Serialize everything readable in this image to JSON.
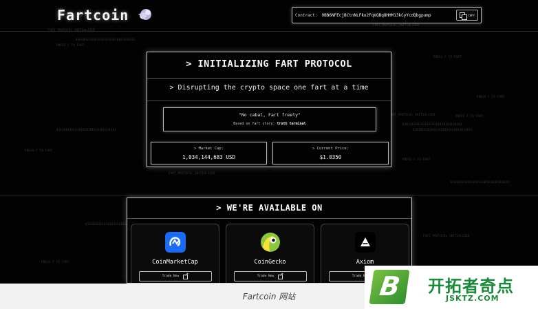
{
  "header": {
    "logo_text": "Fartcoin",
    "logo_icon": "fart-cloud-icon",
    "contract_label": "Contract:",
    "contract_address": "9BB6NFEcjBCtnNLFko2FqVQBq8HHM13kCyYcdQbgpump",
    "copy_label": "COPY"
  },
  "hero": {
    "title": "> INITIALIZING FART PROTOCOL",
    "tagline": "> Disrupting the crypto space one fart at a time",
    "quote": "\"No cabal, Fart freely\"",
    "story_prefix": "Based on fart story:",
    "story_link": "truth terminal",
    "market_cap_label": "> Market Cap:",
    "market_cap_value": "1,034,144,683 USD",
    "price_label": "> Current Price:",
    "price_value": "$1.0350"
  },
  "available": {
    "title": "> WE'RE AVAILABLE ON",
    "exchanges": [
      {
        "name": "CoinMarketCap",
        "icon": "coinmarketcap-icon",
        "button": "Trade Now",
        "color": "#1a6cf5"
      },
      {
        "name": "CoinGecko",
        "icon": "coingecko-icon",
        "button": "Trade Now",
        "color": "#8dc63f"
      },
      {
        "name": "Axiom",
        "icon": "axiom-icon",
        "button": "Trade Now",
        "color": "#000000"
      }
    ]
  },
  "background_text": {
    "a": "FART_PROTOCOL_INITIALIZED",
    "b": "PRESS F TO FART",
    "c": "01010101010101010101010101010101",
    "d": "FART_PROTOCOL_INITIALIZED",
    "e": "PRESS F TO FART"
  },
  "caption": "Fartcoin 网站",
  "watermark": {
    "cn": "开拓者奇点",
    "en": "JSKTZ.COM"
  }
}
